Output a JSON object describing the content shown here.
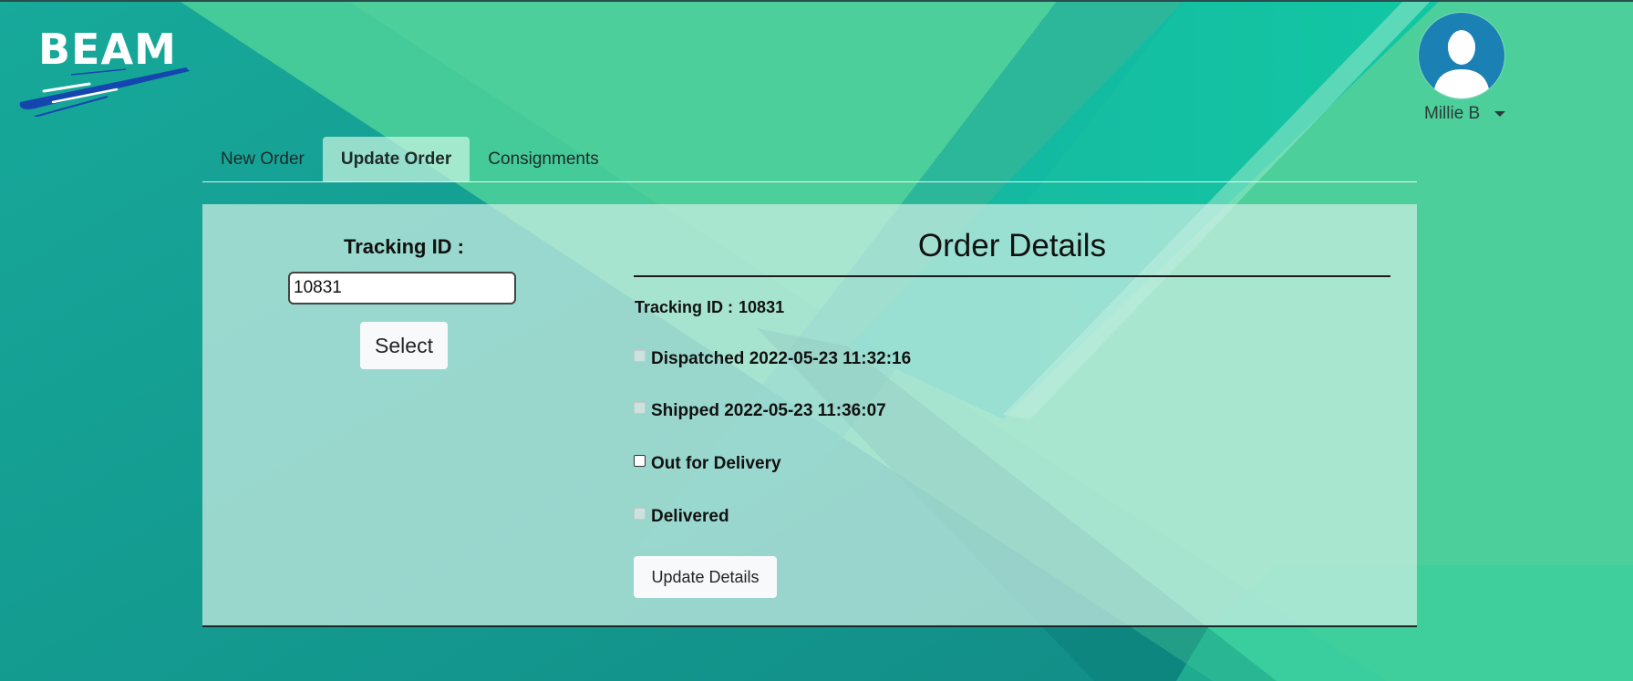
{
  "app": {
    "logo_text": "BEAM"
  },
  "user": {
    "name": "Millie B",
    "avatar_icon": "user-avatar-icon"
  },
  "tabs": [
    {
      "label": "New Order",
      "active": false
    },
    {
      "label": "Update Order",
      "active": true
    },
    {
      "label": "Consignments",
      "active": false
    }
  ],
  "search": {
    "label": "Tracking ID :",
    "value": "10831",
    "button_label": "Select"
  },
  "order": {
    "title": "Order Details",
    "tracking_label": "Tracking ID :",
    "tracking_value": "10831",
    "statuses": [
      {
        "label": "Dispatched 2022-05-23 11:32:16",
        "checked": false,
        "disabled": true
      },
      {
        "label": "Shipped 2022-05-23 11:36:07",
        "checked": false,
        "disabled": true
      },
      {
        "label": "Out for Delivery",
        "checked": false,
        "disabled": false
      },
      {
        "label": "Delivered",
        "checked": false,
        "disabled": true
      }
    ],
    "update_button_label": "Update Details"
  },
  "colors": {
    "background": "#4ccf9a",
    "avatar": "#1b80b4",
    "logo_swoosh": "#1446b0"
  }
}
